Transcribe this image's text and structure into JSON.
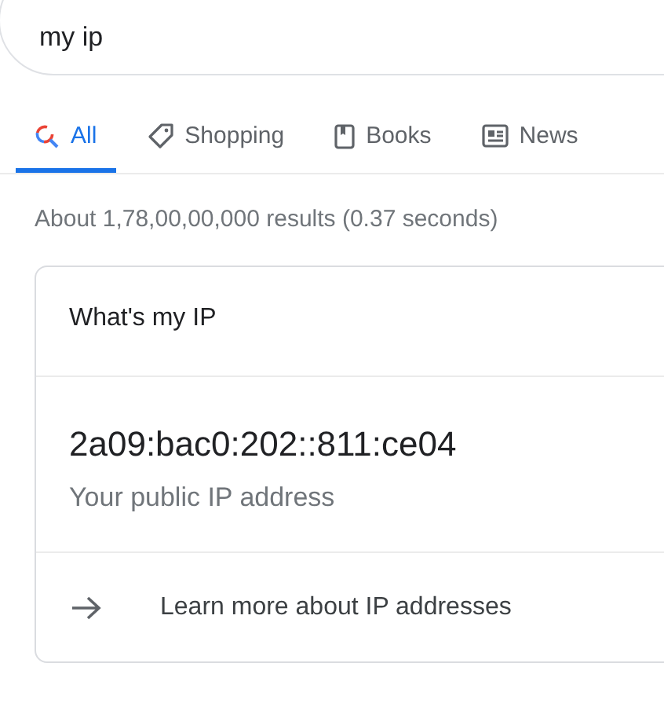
{
  "search": {
    "value": "my ip"
  },
  "tabs": [
    {
      "label": "All",
      "kind": "search",
      "selected": true
    },
    {
      "label": "Shopping",
      "kind": "tag",
      "selected": false
    },
    {
      "label": "Books",
      "kind": "book",
      "selected": false
    },
    {
      "label": "News",
      "kind": "news",
      "selected": false
    }
  ],
  "result_stats": "About 1,78,00,00,000 results (0.37 seconds)",
  "card": {
    "title": "What's my IP",
    "ip": "2a09:bac0:202::811:ce04",
    "caption": "Your public IP address",
    "link": "Learn more about IP addresses"
  }
}
